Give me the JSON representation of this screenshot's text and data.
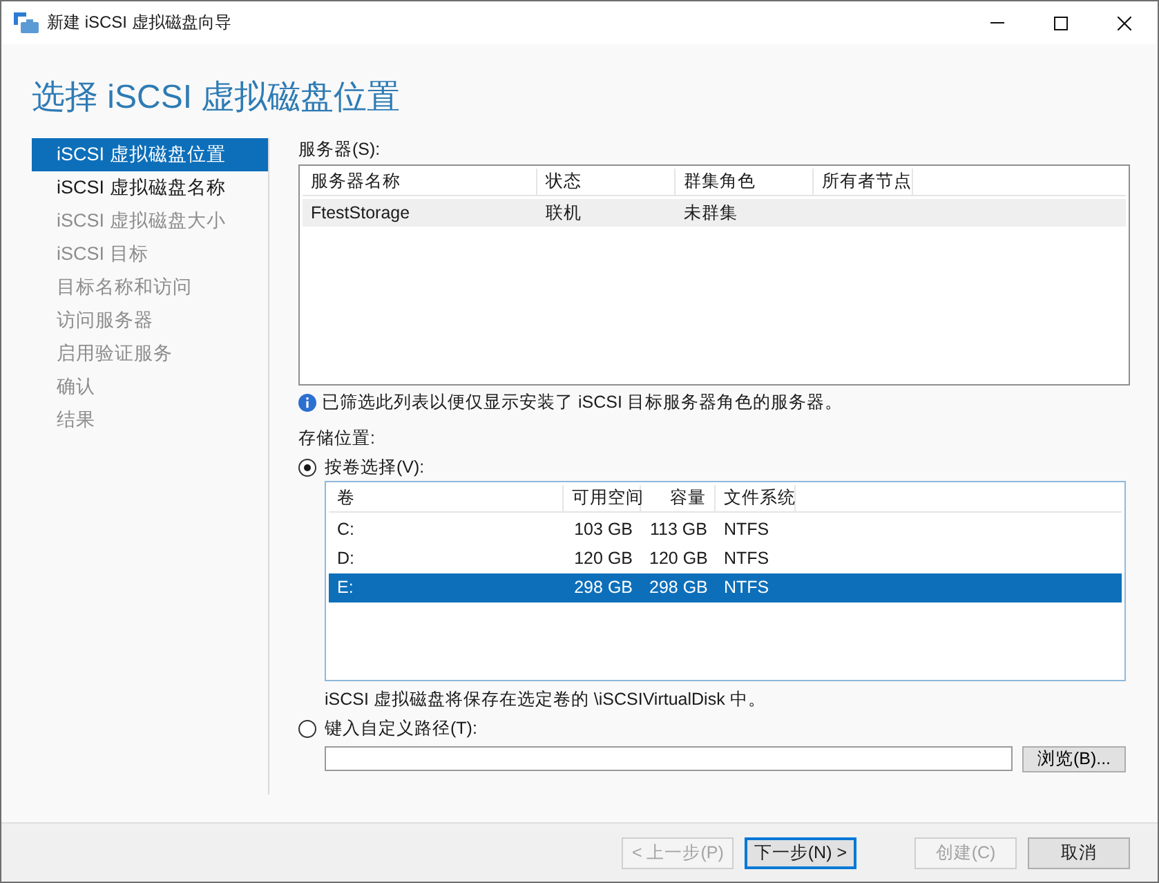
{
  "window": {
    "title": "新建 iSCSI 虚拟磁盘向导"
  },
  "heading": "选择 iSCSI 虚拟磁盘位置",
  "steps": [
    {
      "label": "iSCSI 虚拟磁盘位置",
      "selected": true,
      "disabled": false
    },
    {
      "label": "iSCSI 虚拟磁盘名称",
      "selected": false,
      "disabled": false
    },
    {
      "label": "iSCSI 虚拟磁盘大小",
      "selected": false,
      "disabled": true
    },
    {
      "label": "iSCSI 目标",
      "selected": false,
      "disabled": true
    },
    {
      "label": "目标名称和访问",
      "selected": false,
      "disabled": true
    },
    {
      "label": "访问服务器",
      "selected": false,
      "disabled": true
    },
    {
      "label": "启用验证服务",
      "selected": false,
      "disabled": true
    },
    {
      "label": "确认",
      "selected": false,
      "disabled": true
    },
    {
      "label": "结果",
      "selected": false,
      "disabled": true
    }
  ],
  "servers": {
    "label": "服务器(S):",
    "columns": [
      {
        "label": "服务器名称"
      },
      {
        "label": "状态"
      },
      {
        "label": "群集角色"
      },
      {
        "label": "所有者节点"
      }
    ],
    "rows": [
      {
        "cells": [
          "FtestStorage",
          "联机",
          "未群集",
          ""
        ],
        "selected": true
      }
    ],
    "info": "已筛选此列表以便仅显示安装了 iSCSI 目标服务器角色的服务器。"
  },
  "storage": {
    "label": "存储位置:",
    "options": [
      {
        "kind": "volumes",
        "label": "按卷选择(V):",
        "selected": true,
        "columns": [
          {
            "label": "卷"
          },
          {
            "label": "可用空间",
            "kind": "number"
          },
          {
            "label": "容量",
            "kind": "number"
          },
          {
            "label": "文件系统"
          }
        ],
        "rows": [
          {
            "cells": [
              "C:",
              "103 GB",
              "113 GB",
              "NTFS"
            ],
            "selected": false
          },
          {
            "cells": [
              "D:",
              "120 GB",
              "120 GB",
              "NTFS"
            ],
            "selected": false
          },
          {
            "cells": [
              "E:",
              "298 GB",
              "298 GB",
              "NTFS"
            ],
            "selected": true
          }
        ],
        "note": "iSCSI 虚拟磁盘将保存在选定卷的 \\iSCSIVirtualDisk 中。"
      },
      {
        "kind": "path",
        "label": "键入自定义路径(T):",
        "selected": false,
        "browse": "浏览(B)..."
      }
    ]
  },
  "buttons": [
    {
      "label": "< 上一步(P)",
      "disabled": true,
      "default": false
    },
    {
      "label": "下一步(N) >",
      "disabled": false,
      "default": true
    },
    {
      "label": "创建(C)",
      "disabled": true,
      "default": false
    },
    {
      "label": "取消",
      "disabled": false,
      "default": false
    }
  ]
}
